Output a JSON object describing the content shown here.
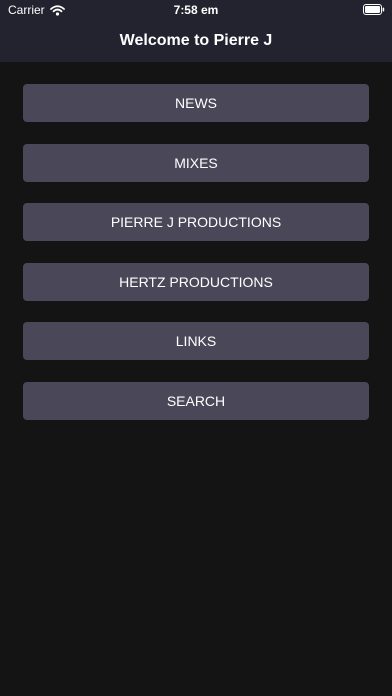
{
  "status_bar": {
    "carrier": "Carrier",
    "time": "7:58 em",
    "wifi_icon": "wifi-icon",
    "battery_icon": "battery-icon"
  },
  "header": {
    "title": "Welcome to Pierre J"
  },
  "menu": {
    "items": [
      {
        "label": "NEWS"
      },
      {
        "label": "MIXES"
      },
      {
        "label": "PIERRE J PRODUCTIONS"
      },
      {
        "label": "HERTZ PRODUCTIONS"
      },
      {
        "label": "LINKS"
      },
      {
        "label": "SEARCH"
      }
    ]
  },
  "colors": {
    "background": "#141414",
    "header": "#23222f",
    "button": "#4a4858",
    "text": "#ffffff"
  }
}
